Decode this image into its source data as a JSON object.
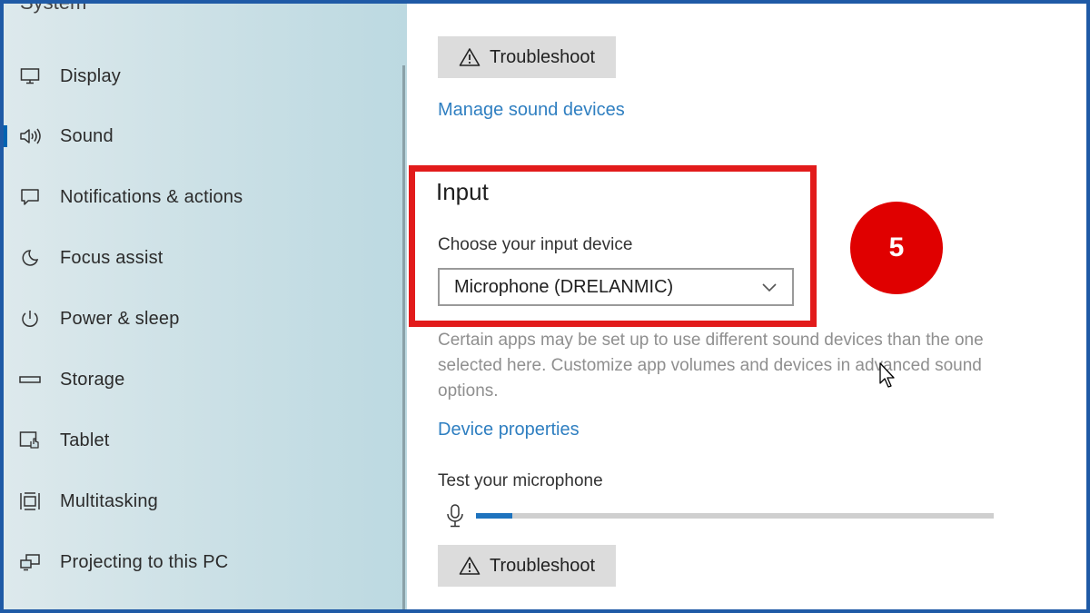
{
  "sidebar": {
    "header": "System",
    "items": [
      {
        "label": "Display",
        "icon": "display-icon",
        "active": false
      },
      {
        "label": "Sound",
        "icon": "speaker-icon",
        "active": true
      },
      {
        "label": "Notifications & actions",
        "icon": "notification-icon",
        "active": false
      },
      {
        "label": "Focus assist",
        "icon": "moon-icon",
        "active": false
      },
      {
        "label": "Power & sleep",
        "icon": "power-icon",
        "active": false
      },
      {
        "label": "Storage",
        "icon": "storage-icon",
        "active": false
      },
      {
        "label": "Tablet",
        "icon": "tablet-icon",
        "active": false
      },
      {
        "label": "Multitasking",
        "icon": "multitasking-icon",
        "active": false
      },
      {
        "label": "Projecting to this PC",
        "icon": "projecting-icon",
        "active": false
      }
    ]
  },
  "main": {
    "output_troubleshoot_label": "Troubleshoot",
    "manage_devices_link": "Manage sound devices",
    "input": {
      "heading": "Input",
      "choose_label": "Choose your input device",
      "selected_device": "Microphone (DRELANMIC)",
      "description": "Certain apps may be set up to use different sound devices than the one selected here. Customize app volumes and devices in advanced sound options.",
      "device_properties_link": "Device properties",
      "test_label": "Test your microphone",
      "mic_level_percent": 7,
      "troubleshoot_label": "Troubleshoot"
    }
  },
  "annotation": {
    "step_number": "5",
    "color": "#e21b1b"
  },
  "colors": {
    "accent": "#0063b1",
    "link": "#2f7fc1",
    "highlight_border": "#e21b1b",
    "badge": "#e00000",
    "frame": "#1f5aa6"
  }
}
